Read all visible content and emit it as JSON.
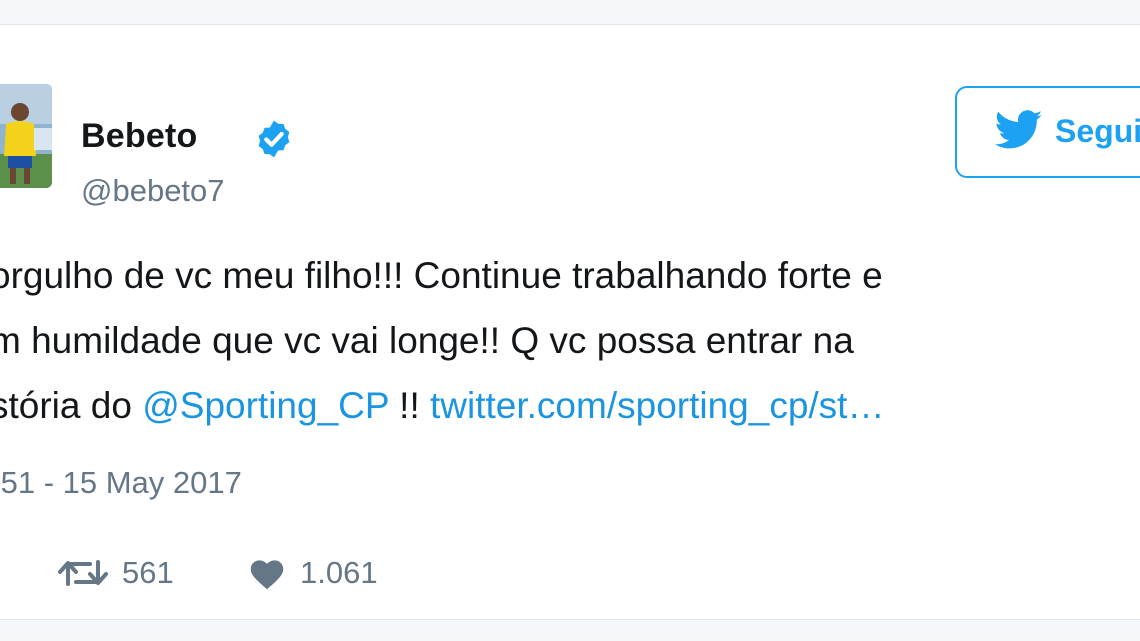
{
  "author": {
    "display_name": "Bebeto",
    "handle": "@bebeto7",
    "verified": true
  },
  "follow_button": {
    "label": "Seguir"
  },
  "tweet": {
    "line1": "orgulho de vc meu filho!!! Continue trabalhando forte e",
    "line2": "m humildade que vc vai longe!! Q vc possa entrar na",
    "line3_prefix": "stória do ",
    "line3_mention": "@Sporting_CP",
    "line3_middle": " !! ",
    "line3_link": "twitter.com/sporting_cp/st…"
  },
  "timestamp": ":51 - 15 May 2017",
  "stats": {
    "retweets": "561",
    "likes": "1.061"
  },
  "colors": {
    "accent": "#1da1f2",
    "link": "#1b95e0",
    "text": "#14171a",
    "secondary": "#657786"
  },
  "icons": [
    "verified-badge-icon",
    "twitter-bird-icon",
    "retweet-icon",
    "heart-icon"
  ]
}
